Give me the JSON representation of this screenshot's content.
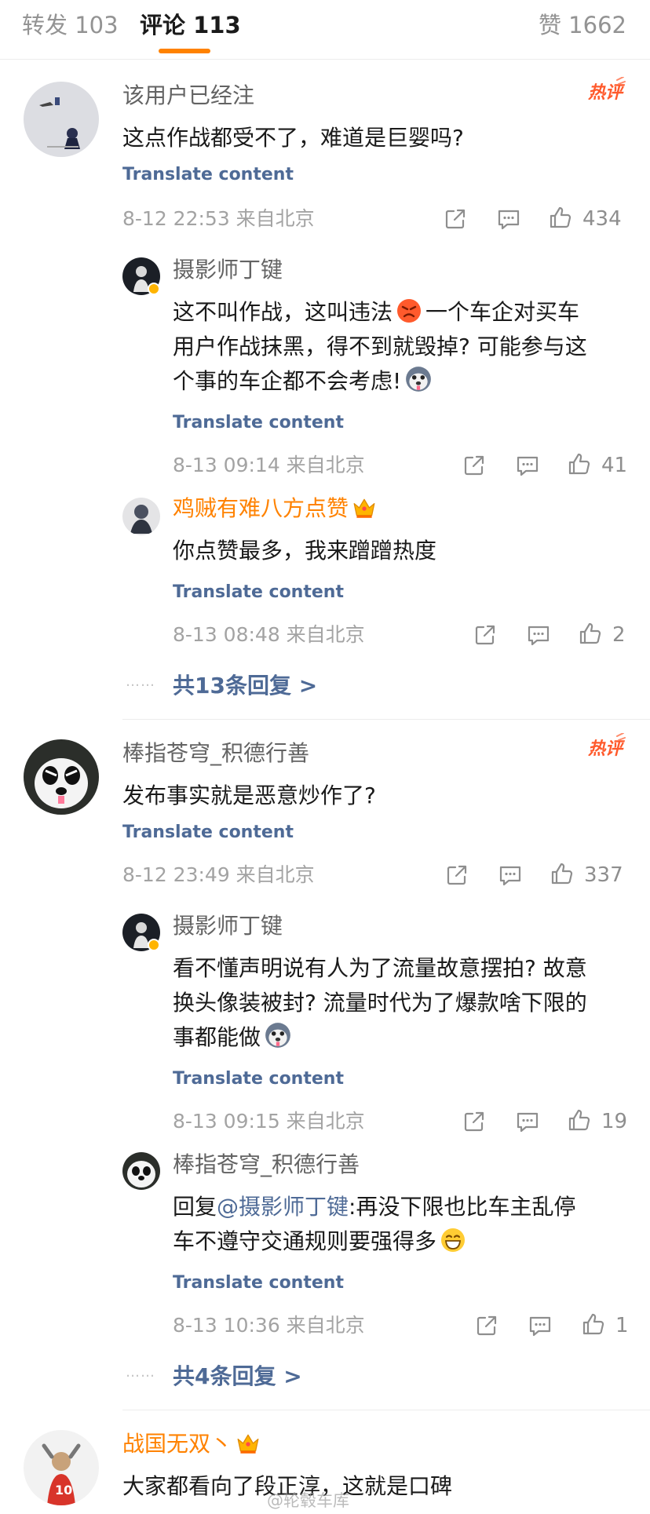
{
  "tabs": {
    "reposts": "转发 103",
    "comments": "评论 113",
    "likes": "赞 1662"
  },
  "colors": {
    "accent": "#ff8200",
    "link": "#4e6a96",
    "meta": "#a3a3a3"
  },
  "icons": [
    "share-icon",
    "comment-icon",
    "like-icon",
    "hot-badge",
    "crown-icon",
    "verified-badge"
  ],
  "thread1": {
    "comment": {
      "username": "该用户已经注",
      "badge": "热评",
      "text": "这点作战都受不了，难道是巨婴吗?",
      "translate": "Translate content",
      "time": "8-12 22:53 来自北京",
      "likes": "434"
    },
    "reply1": {
      "username": "摄影师丁键",
      "line1a": "这不叫作战，这叫违法",
      "line1b": "一个车企对买车",
      "line2": "用户作战抹黑，得不到就毁掉? 可能参与这",
      "line3": "个事的车企都不会考虑!",
      "translate": "Translate content",
      "time": "8-13 09:14 来自北京",
      "likes": "41"
    },
    "reply2": {
      "username": "鸡贼有难八方点赞",
      "text": "你点赞最多，我来蹭蹭热度",
      "translate": "Translate content",
      "time": "8-13 08:48 来自北京",
      "likes": "2"
    },
    "more": "共13条回复 >"
  },
  "thread2": {
    "comment": {
      "username": "棒指苍穹_积德行善",
      "badge": "热评",
      "text": "发布事实就是恶意炒作了?",
      "translate": "Translate content",
      "time": "8-12 23:49 来自北京",
      "likes": "337"
    },
    "reply1": {
      "username": "摄影师丁键",
      "line1": "看不懂声明说有人为了流量故意摆拍? 故意",
      "line2": "换头像装被封? 流量时代为了爆款啥下限的",
      "line3": "事都能做",
      "translate": "Translate content",
      "time": "8-13 09:15 来自北京",
      "likes": "19"
    },
    "reply2": {
      "username": "棒指苍穹_积德行善",
      "prefix": "回复",
      "mention": "@摄影师丁键",
      "line1": ":再没下限也比车主乱停",
      "line2": "车不遵守交通规则要强得多",
      "translate": "Translate content",
      "time": "8-13 10:36 来自北京",
      "likes": "1"
    },
    "more": "共4条回复 >"
  },
  "thread3": {
    "comment": {
      "username": "战国无双丶",
      "text": "大家都看向了段正淳，这就是口碑"
    }
  },
  "watermark": "@轮毂车库"
}
